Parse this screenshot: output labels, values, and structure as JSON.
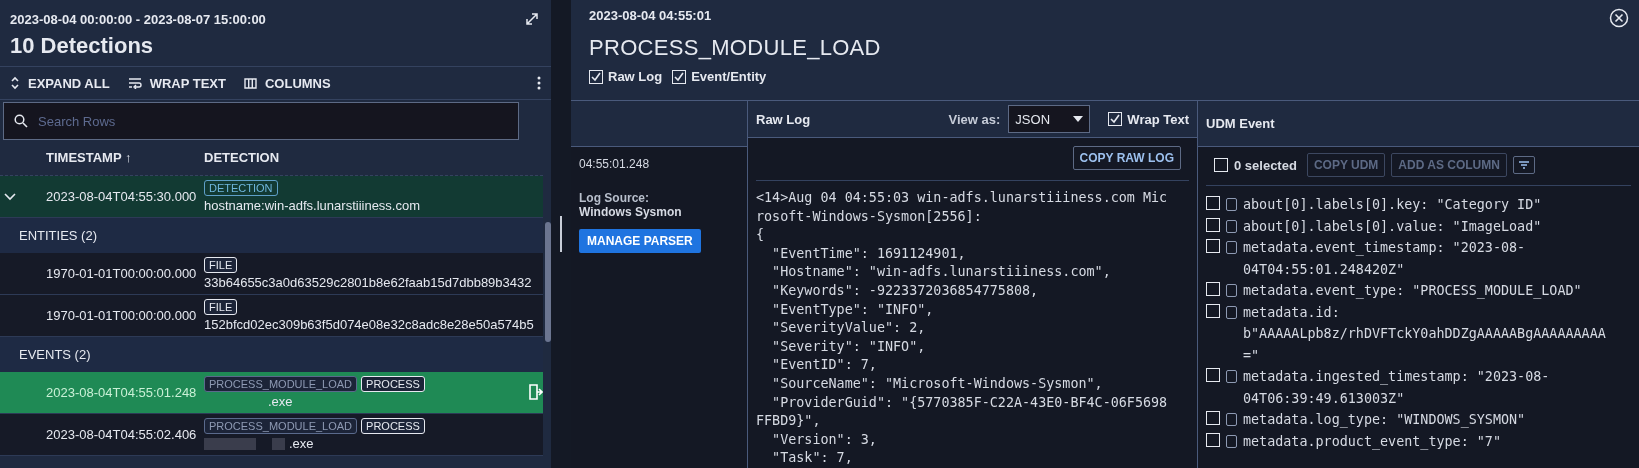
{
  "left": {
    "range": "2023-08-04 00:00:00 - 2023-08-07 15:00:00",
    "title": "10 Detections",
    "toolbar": [
      {
        "kind": "expand",
        "label": "EXPAND ALL"
      },
      {
        "kind": "wrap",
        "label": "WRAP TEXT"
      },
      {
        "kind": "columns",
        "label": "COLUMNS"
      }
    ],
    "search": {
      "placeholder": "Search Rows"
    },
    "columns": [
      {
        "label": "TIMESTAMP ↑"
      },
      {
        "label": "DETECTION"
      }
    ],
    "rows": [
      {
        "kind": "detection",
        "expanded": true,
        "selected": false,
        "timestamp": "2023-08-04T04:55:30.000",
        "tags": [
          "DETECTION"
        ],
        "text": "hostname:win-adfs.lunarstiiiness.com"
      },
      {
        "kind": "section",
        "label": "ENTITIES (2)"
      },
      {
        "kind": "entity",
        "selected": false,
        "timestamp": "1970-01-01T00:00:00.000",
        "tags": [
          "FILE"
        ],
        "text": "33b64655c3a0d63529c2801b8e62faab15d7dbb89b3432"
      },
      {
        "kind": "entity",
        "selected": false,
        "timestamp": "1970-01-01T00:00:00.000",
        "tags": [
          "FILE"
        ],
        "text": "152bfcd02ec309b63f5d074e08e32c8adc8e28e50a574b5"
      },
      {
        "kind": "section",
        "label": "EVENTS (2)"
      },
      {
        "kind": "event",
        "selected": true,
        "timestamp": "2023-08-04T04:55:01.248",
        "tags": [
          "PROCESS_MODULE_LOAD",
          "PROCESS"
        ],
        "text": ".exe"
      },
      {
        "kind": "event",
        "selected": false,
        "timestamp": "2023-08-04T04:55:02.406",
        "tags": [
          "PROCESS_MODULE_LOAD",
          "PROCESS"
        ],
        "text": ".exe"
      }
    ]
  },
  "detail": {
    "time": "2023-08-04 04:55:01",
    "title": "PROCESS_MODULE_LOAD",
    "toggles": [
      {
        "label": "Raw Log",
        "checked": true
      },
      {
        "label": "Event/Entity",
        "checked": true
      }
    ],
    "info": {
      "time": "04:55:01.248",
      "source_label": "Log Source:",
      "source": "Windows Sysmon",
      "button": "MANAGE PARSER"
    },
    "raw_log": {
      "heading": "Raw Log",
      "view_label": "View as:",
      "view_value": "JSON",
      "wrap": {
        "label": "Wrap Text",
        "checked": true
      },
      "copy": "COPY RAW LOG",
      "lines": [
        "<14>Aug 04 04:55:03 win-adfs.lunarstiiiness.com Mic",
        "rosoft-Windows-Sysmon[2556]:",
        "{",
        "  \"EventTime\": 1691124901,",
        "  \"Hostname\": \"win-adfs.lunarstiiiness.com\",",
        "  \"Keywords\": -9223372036854775808,",
        "  \"EventType\": \"INFO\",",
        "  \"SeverityValue\": 2,",
        "  \"Severity\": \"INFO\",",
        "  \"EventID\": 7,",
        "  \"SourceName\": \"Microsoft-Windows-Sysmon\",",
        "  \"ProviderGuid\": \"{5770385F-C22A-43E0-BF4C-06F5698",
        "FFBD9}\",",
        "  \"Version\": 3,",
        "  \"Task\": 7,"
      ]
    },
    "udm": {
      "heading": "UDM Event",
      "select_all": {
        "label": "0 selected",
        "checked": false
      },
      "copy": "COPY UDM",
      "add": "ADD AS COLUMN",
      "fields": [
        {
          "checked": false,
          "lines": [
            "about[0].labels[0].key: \"Category ID\""
          ]
        },
        {
          "checked": false,
          "lines": [
            "about[0].labels[0].value: \"ImageLoad\""
          ]
        },
        {
          "checked": false,
          "lines": [
            "metadata.event_timestamp: \"2023-08-",
            "04T04:55:01.248420Z\""
          ]
        },
        {
          "checked": false,
          "lines": [
            "metadata.event_type: \"PROCESS_MODULE_LOAD\""
          ]
        },
        {
          "checked": false,
          "lines": [
            "metadata.id:",
            "b\"AAAAALpb8z/rhDVFTckY0ahDDZgAAAAABgAAAAAAAAA",
            "=\""
          ]
        },
        {
          "checked": false,
          "lines": [
            "metadata.ingested_timestamp: \"2023-08-",
            "04T06:39:49.613003Z\""
          ]
        },
        {
          "checked": false,
          "lines": [
            "metadata.log_type: \"WINDOWS_SYSMON\""
          ]
        },
        {
          "checked": false,
          "lines": [
            "metadata.product_event_type: \"7\""
          ]
        }
      ]
    }
  }
}
